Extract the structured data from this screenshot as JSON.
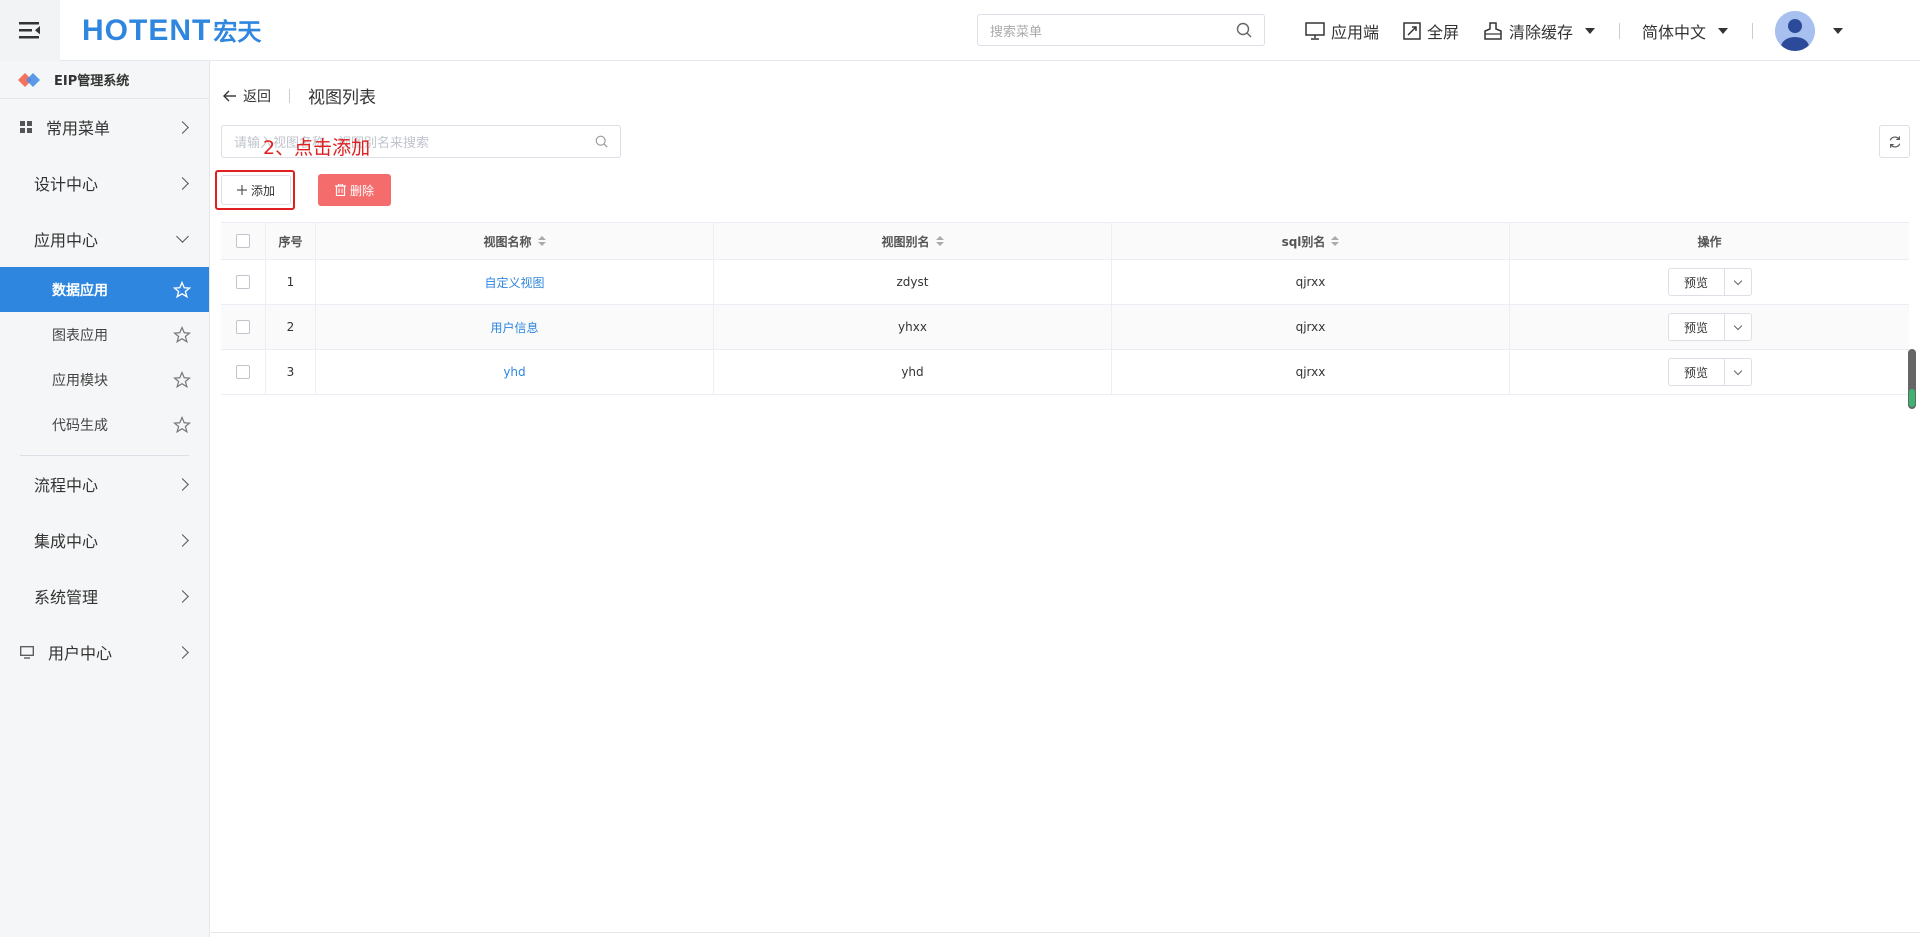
{
  "header": {
    "logo_brand": "HOTENT",
    "logo_cn": "宏天",
    "search_placeholder": "搜索菜单",
    "app_end": "应用端",
    "fullscreen": "全屏",
    "clear_cache": "清除缓存",
    "language": "简体中文"
  },
  "sidebar": {
    "system_name": "EIP管理系统",
    "groups": [
      {
        "label": "常用菜单"
      },
      {
        "label": "设计中心"
      },
      {
        "label": "应用中心"
      }
    ],
    "sub_items": [
      {
        "label": "数据应用",
        "active": true
      },
      {
        "label": "图表应用"
      },
      {
        "label": "应用模块"
      },
      {
        "label": "代码生成"
      }
    ],
    "groups_after": [
      {
        "label": "流程中心"
      },
      {
        "label": "集成中心"
      },
      {
        "label": "系统管理"
      },
      {
        "label": "用户中心"
      }
    ]
  },
  "main": {
    "back_label": "返回",
    "page_title": "视图列表",
    "search_placeholder": "请输入视图名称、视图别名来搜索",
    "annotation": "2、点击添加",
    "add_label": "添加",
    "delete_label": "删除",
    "table": {
      "headers": [
        "序号",
        "视图名称",
        "视图别名",
        "sql别名",
        "操作"
      ],
      "rows": [
        {
          "index": "1",
          "name": "自定义视图",
          "alias": "zdyst",
          "sql": "qjrxx",
          "op": "预览"
        },
        {
          "index": "2",
          "name": "用户信息",
          "alias": "yhxx",
          "sql": "qjrxx",
          "op": "预览"
        },
        {
          "index": "3",
          "name": "yhd",
          "alias": "yhd",
          "sql": "qjrxx",
          "op": "预览"
        }
      ]
    }
  },
  "colors": {
    "accent": "#2e86de",
    "danger": "#f56c6c",
    "annotation": "#e02020"
  }
}
